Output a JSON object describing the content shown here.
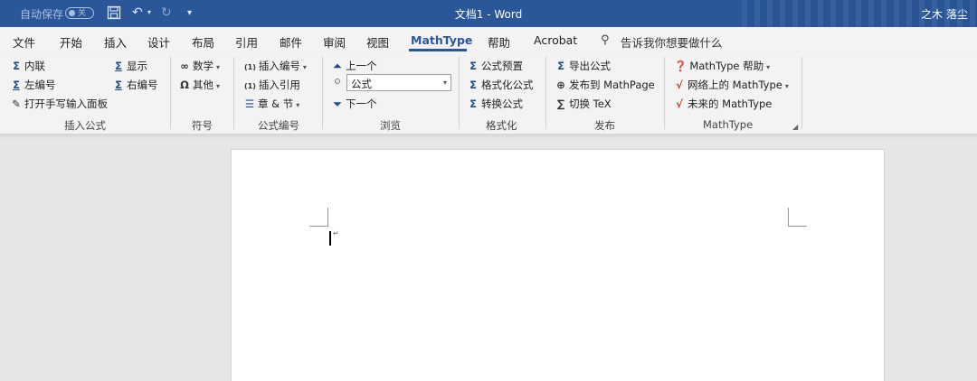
{
  "title_bar": {
    "autosave_label": "自动保存",
    "autosave_state": "关",
    "window_title": "文档1  -  Word",
    "user": "之木 落尘"
  },
  "menu": {
    "tabs": [
      "文件",
      "开始",
      "插入",
      "设计",
      "布局",
      "引用",
      "邮件",
      "审阅",
      "视图",
      "MathType",
      "帮助",
      "Acrobat"
    ],
    "active_tab": "MathType",
    "tell_me": "告诉我你想要做什么"
  },
  "ribbon": {
    "insert_formula": {
      "label": "插入公式",
      "inline": "内联",
      "display": "显示",
      "left_number": "左编号",
      "right_number": "右编号",
      "handwriting": "打开手写输入面板"
    },
    "symbols": {
      "label": "符号",
      "math": "数学",
      "other": "其他"
    },
    "formula_number": {
      "label": "公式编号",
      "insert_number": "插入编号",
      "insert_reference": "插入引用",
      "chapter_section": "章 & 节"
    },
    "browse": {
      "label": "浏览",
      "previous": "上一个",
      "combo_value": "公式",
      "next": "下一个"
    },
    "format": {
      "label": "格式化",
      "preset": "公式预置",
      "format_formula": "格式化公式",
      "convert_formula": "转换公式"
    },
    "publish": {
      "label": "发布",
      "export": "导出公式",
      "publish_mathpage": "发布到 MathPage",
      "toggle_tex": "切换 TeX"
    },
    "mathtype": {
      "label": "MathType",
      "help": "MathType 帮助",
      "on_web": "网络上的 MathType",
      "future": "未来的 MathType"
    }
  },
  "colors": {
    "accent": "#2b579a",
    "ribbon_bg": "#f3f3f3",
    "canvas_bg": "#e6e6e6"
  }
}
